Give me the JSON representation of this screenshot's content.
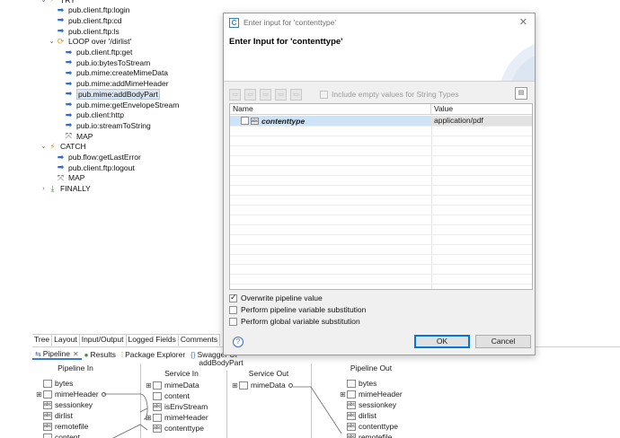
{
  "tree": {
    "items": [
      {
        "label": "TRY",
        "icon": "try-icon",
        "depth": 0,
        "twisty": "open"
      },
      {
        "label": "pub.client.ftp:login",
        "icon": "invoke-icon",
        "depth": 1
      },
      {
        "label": "pub.client.ftp:cd",
        "icon": "invoke-icon",
        "depth": 1
      },
      {
        "label": "pub.client.ftp:ls",
        "icon": "invoke-icon",
        "depth": 1
      },
      {
        "label": "LOOP over '/dirlist'",
        "icon": "loop-icon",
        "depth": 1,
        "twisty": "open"
      },
      {
        "label": "pub.client.ftp:get",
        "icon": "invoke-icon",
        "depth": 2
      },
      {
        "label": "pub.io:bytesToStream",
        "icon": "invoke-icon",
        "depth": 2
      },
      {
        "label": "pub.mime:createMimeData",
        "icon": "invoke-icon",
        "depth": 2
      },
      {
        "label": "pub.mime:addMimeHeader",
        "icon": "invoke-icon",
        "depth": 2
      },
      {
        "label": "pub.mime:addBodyPart",
        "icon": "invoke-icon",
        "depth": 2,
        "selected": true
      },
      {
        "label": "pub.mime:getEnvelopeStream",
        "icon": "invoke-icon",
        "depth": 2
      },
      {
        "label": "pub.client:http",
        "icon": "invoke-icon",
        "depth": 2
      },
      {
        "label": "pub.io:streamToString",
        "icon": "invoke-icon",
        "depth": 2
      },
      {
        "label": "MAP",
        "icon": "map-icon",
        "depth": 2
      },
      {
        "label": "CATCH",
        "icon": "catch-icon",
        "depth": 0,
        "twisty": "open"
      },
      {
        "label": "pub.flow:getLastError",
        "icon": "invoke-icon",
        "depth": 1
      },
      {
        "label": "pub.client.ftp:logout",
        "icon": "invoke-icon",
        "depth": 1
      },
      {
        "label": "MAP",
        "icon": "map-icon",
        "depth": 1
      },
      {
        "label": "FINALLY",
        "icon": "finally-icon",
        "depth": 0,
        "twisty": "closed"
      }
    ]
  },
  "view_tabs": [
    "Tree",
    "Layout",
    "Input/Output",
    "Logged Fields",
    "Comments"
  ],
  "lower_tabs": [
    {
      "label": "Pipeline",
      "active": true,
      "closable": true
    },
    {
      "label": "Results",
      "active": false
    },
    {
      "label": "Package Explorer",
      "active": false
    },
    {
      "label": "Swagger UI",
      "active": false
    }
  ],
  "pipeline": {
    "headers": {
      "pipeline_in": "Pipeline In",
      "service_in": "Service In",
      "service_out": "Service Out",
      "pipeline_out": "Pipeline Out",
      "service_name": "addBodyPart"
    },
    "pipeline_in_vars": [
      "bytes",
      "mimeHeader",
      "sessionkey",
      "dirlist",
      "remotefile",
      "content"
    ],
    "service_in_vars": [
      "mimeData",
      "content",
      "isEnvStream",
      "mimeHeader",
      "contenttype"
    ],
    "service_out_vars": [
      "mimeData"
    ],
    "pipeline_out_vars": [
      "bytes",
      "mimeHeader",
      "sessionkey",
      "dirlist",
      "contenttype",
      "remotefile"
    ]
  },
  "dialog": {
    "title": "Enter input for 'contenttype'",
    "heading": "Enter Input for 'contenttype'",
    "include_empty_label": "Include empty values for String Types",
    "table": {
      "col_name": "Name",
      "col_value": "Value",
      "rows": [
        {
          "name": "contenttype",
          "value": "application/pdf"
        }
      ]
    },
    "options": [
      {
        "label": "Overwrite pipeline value",
        "checked": true
      },
      {
        "label": "Perform pipeline variable substitution",
        "checked": false
      },
      {
        "label": "Perform global variable substitution",
        "checked": false
      }
    ],
    "ok_label": "OK",
    "cancel_label": "Cancel",
    "help_glyph": "?",
    "close_glyph": "✕"
  },
  "colors": {
    "selection": "#cde3f7",
    "accent": "#0078d7",
    "invoke": "#2f6fc9"
  }
}
